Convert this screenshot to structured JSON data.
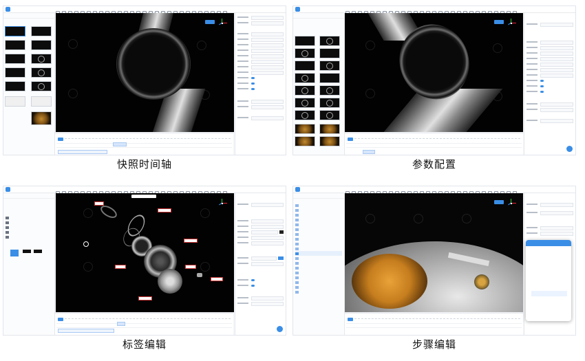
{
  "captions": [
    "快照时间轴",
    "参数配置",
    "标签编辑",
    "步骤编辑"
  ],
  "colors": {
    "accent": "#3a8ee6",
    "viewport_bg": "#020202",
    "label_border": "#cc3333"
  },
  "icons": [
    "app-logo-icon",
    "gizmo-axes-icon",
    "watermark-icon",
    "folder-icon",
    "fab-icon"
  ]
}
